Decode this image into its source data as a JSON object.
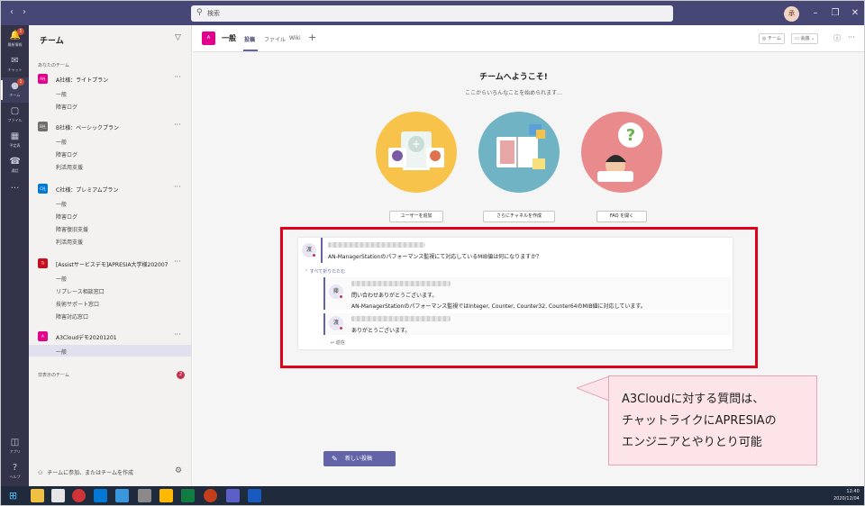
{
  "search": {
    "placeholder": "検索"
  },
  "user": {
    "avatar_initial": "承"
  },
  "rail": {
    "items": [
      {
        "label": "最新情報",
        "icon": "bell-icon",
        "badge": "1"
      },
      {
        "label": "チャット",
        "icon": "chat-icon",
        "badge": ""
      },
      {
        "label": "チーム",
        "icon": "teams-icon",
        "badge": "1"
      },
      {
        "label": "ファイル",
        "icon": "file-icon",
        "badge": ""
      },
      {
        "label": "予定表",
        "icon": "calendar-icon",
        "badge": ""
      },
      {
        "label": "通話",
        "icon": "phone-icon",
        "badge": ""
      },
      {
        "label": "アプリ",
        "icon": "apps-icon",
        "badge": ""
      },
      {
        "label": "ヘルプ",
        "icon": "help-icon",
        "badge": ""
      }
    ]
  },
  "teams_pane": {
    "title": "チーム",
    "section_label": "あなたのチーム",
    "teams": [
      {
        "tile": "A社",
        "tile_color": "#e3008c",
        "name": "A社様：ライトプラン",
        "channels": [
          "一般",
          "障害ログ"
        ]
      },
      {
        "tile": "B社",
        "tile_color": "#6e6e6e",
        "name": "B社様：ベーシックプラン",
        "channels": [
          "一般",
          "障害ログ",
          "利活用支援"
        ]
      },
      {
        "tile": "C社",
        "tile_color": "#0078d4",
        "name": "C社様：プレミアムプラン",
        "channels": [
          "一般",
          "障害ログ",
          "障害復旧支援",
          "利活用支援"
        ]
      },
      {
        "tile": "Tr",
        "tile_color": "#c50f1f",
        "name": "[Assistサービスデモ]APRESIA大学様202007",
        "channels": [
          "一般",
          "リプレース相談窓口",
          "技術サポート窓口",
          "障害対応窓口"
        ]
      },
      {
        "tile": "A",
        "tile_color": "#e3008c",
        "name": "A3Cloudデモ20201201",
        "channels": [
          "一般"
        ]
      }
    ],
    "hidden_label": "非表示のチーム",
    "hidden_count": "2",
    "join_label": "チームに参加、またはチームを作成"
  },
  "channel_header": {
    "tile": "A",
    "title": "一般",
    "tabs": [
      "投稿",
      "ファイル",
      "Wiki"
    ],
    "team_button": "チーム",
    "meet_button": "会議"
  },
  "welcome": {
    "title": "チームへようこそ!",
    "subtitle": "ここからいろんなことを始められます...",
    "actions": [
      "ユーザーを追加",
      "さらにチャネルを作成",
      "FAQ を開く"
    ]
  },
  "conversation": {
    "question_avatar": "渡",
    "question": "AN-ManagerStationのパフォーマンス監視にて対応しているMIB値は何になりますか？",
    "collapse_label": "すべて折りたたむ",
    "replies": [
      {
        "avatar": "藤",
        "lines": [
          "問い合わせありがとうございます。",
          "AN-ManagerStationのパフォーマンス監視ではInteger, Counter, Counter32, Counter64のMIB値に対応しています。"
        ]
      },
      {
        "avatar": "渡",
        "lines": [
          "ありがとうございます。"
        ]
      }
    ],
    "reply_label": "返信"
  },
  "callout": {
    "lines": [
      "A3Cloudに対する質問は、",
      "チャットライクにAPRESIAの",
      "エンジニアとやりとり可能"
    ]
  },
  "new_post_label": "新しい投稿",
  "taskbar": {
    "time": "12:40",
    "date": "2020/12/04"
  },
  "colors": {
    "accent": "#6264a7",
    "highlight": "#e0001b",
    "callout_bg": "#fde4e9"
  }
}
